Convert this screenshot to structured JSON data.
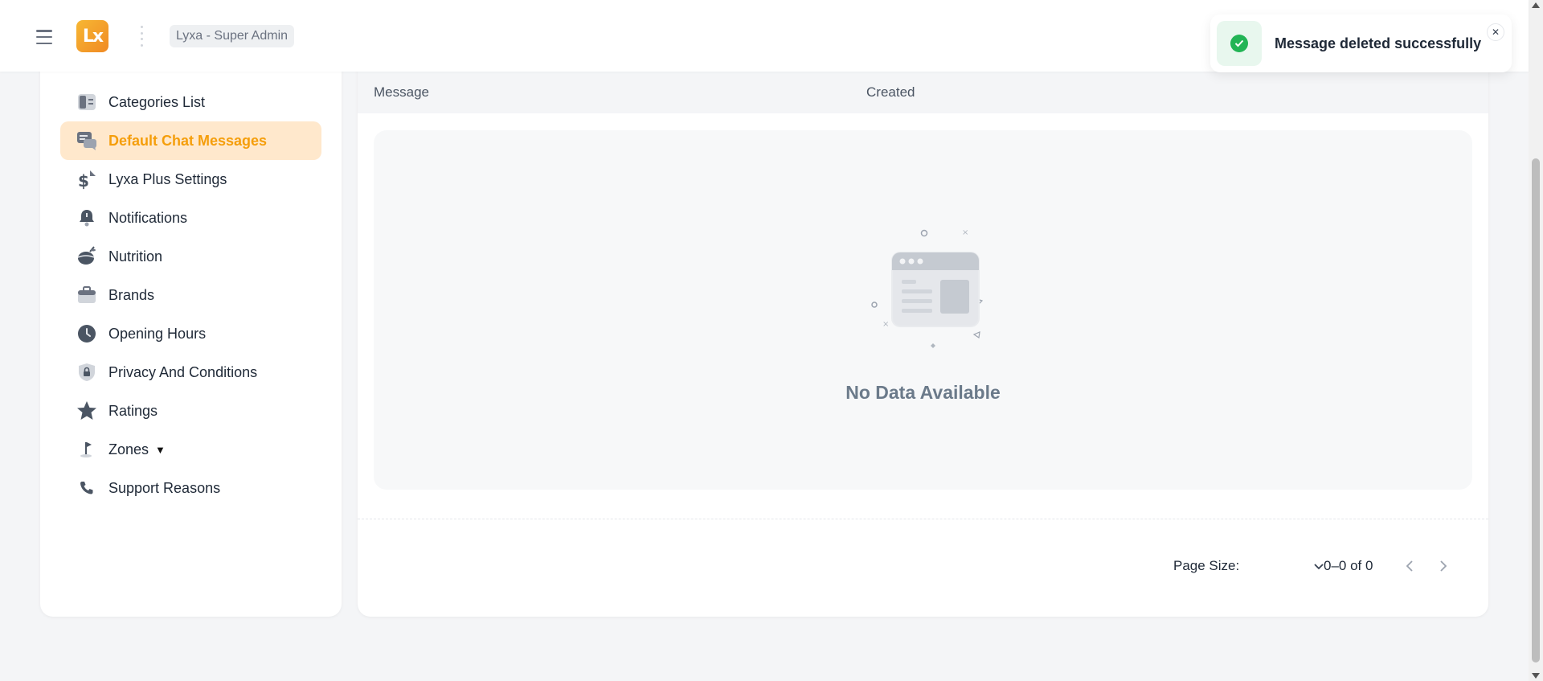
{
  "header": {
    "logo_text": "Lx",
    "org_label": "Lyxa - Super Admin"
  },
  "sidebar": {
    "items": [
      {
        "label": "Categories List",
        "icon": "categories-icon",
        "active": false
      },
      {
        "label": "Default Chat Messages",
        "icon": "chat-icon",
        "active": true
      },
      {
        "label": "Lyxa Plus Settings",
        "icon": "dollar-icon",
        "active": false
      },
      {
        "label": "Notifications",
        "icon": "bell-icon",
        "active": false
      },
      {
        "label": "Nutrition",
        "icon": "nutrition-icon",
        "active": false
      },
      {
        "label": "Brands",
        "icon": "briefcase-icon",
        "active": false
      },
      {
        "label": "Opening Hours",
        "icon": "clock-icon",
        "active": false
      },
      {
        "label": "Privacy And Conditions",
        "icon": "lock-shield-icon",
        "active": false
      },
      {
        "label": "Ratings",
        "icon": "star-icon",
        "active": false
      },
      {
        "label": "Zones",
        "icon": "flag-icon",
        "active": false
      },
      {
        "label": "Support Reasons",
        "icon": "phone-icon",
        "active": false
      }
    ]
  },
  "table": {
    "columns": [
      "Message",
      "Created"
    ],
    "empty_text": "No Data Available"
  },
  "pagination": {
    "page_size_label": "Page Size:",
    "page_size_value": "",
    "range_text": "0–0 of 0"
  },
  "toast": {
    "message": "Message deleted successfully",
    "status": "success"
  },
  "colors": {
    "accent": "#f59e0b",
    "active_bg": "#ffe8cc",
    "success": "#22b455"
  }
}
